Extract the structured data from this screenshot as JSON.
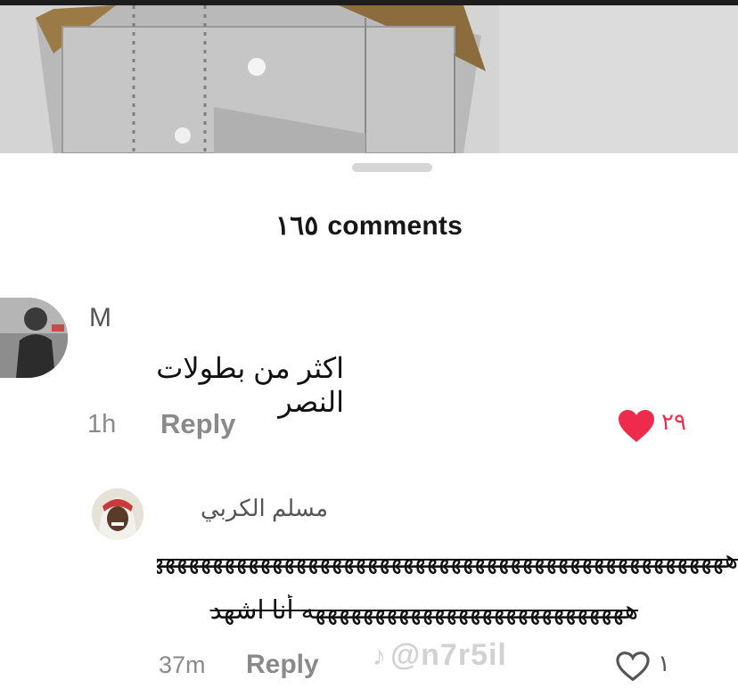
{
  "comments_header": {
    "count": "١٦٥",
    "label": "comments"
  },
  "comments": [
    {
      "username": "M",
      "text": "اكثر من بطولات النصر",
      "time": "1h",
      "reply_label": "Reply",
      "likes": "٢٩",
      "liked": true
    },
    {
      "username": "مسلم الكربي",
      "text_line1": "ههههههههههههههههههههههههههههههههههههههههههههههههههههه",
      "text_line2": "هههههههههههههههههههههههههههه أنا اشهد",
      "time": "37m",
      "reply_label": "Reply",
      "likes": "١",
      "liked": false
    }
  ],
  "watermark": {
    "text": "@n7r5il",
    "icon": "tiktok-icon"
  },
  "colors": {
    "heart_liked": "#ef2b4d",
    "muted": "#8a8a8a"
  }
}
